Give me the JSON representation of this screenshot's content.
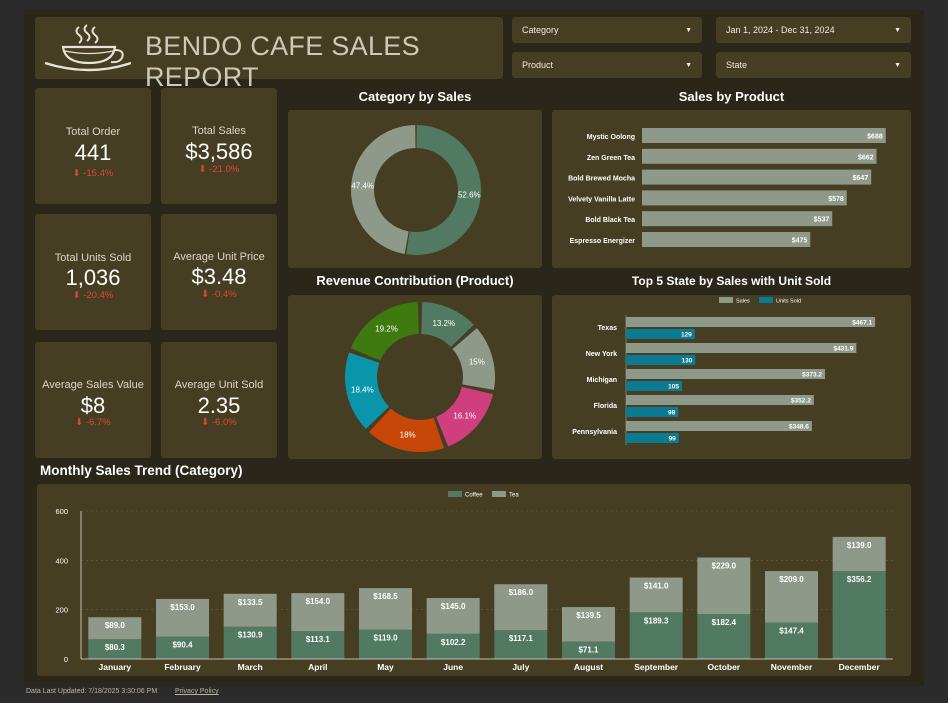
{
  "header": {
    "title": "BENDO CAFE SALES REPORT"
  },
  "filters": {
    "category": "Category",
    "product": "Product",
    "date_range": "Jan 1, 2024 - Dec 31, 2024",
    "state": "State"
  },
  "kpis": [
    {
      "label": "Total Order",
      "value": "441",
      "delta": "⬇ -15.4%"
    },
    {
      "label": "Total Sales",
      "value": "$3,586",
      "delta": "⬇ -21.0%"
    },
    {
      "label": "Total Units Sold",
      "value": "1,036",
      "delta": "⬇ -20.4%"
    },
    {
      "label": "Average Unit Price",
      "value": "$3.48",
      "delta": "⬇ -0.4%"
    },
    {
      "label": "Average Sales Value",
      "value": "$8",
      "delta": "⬇ -6.7%"
    },
    {
      "label": "Average Unit Sold",
      "value": "2.35",
      "delta": "⬇ -6.0%"
    }
  ],
  "colors": {
    "coffee": "#527a62",
    "tea": "#8e998a",
    "units": "#0a7b93",
    "panel": "#463e22",
    "background": "#2a2619",
    "negative": "#e0463b"
  },
  "footer": {
    "updated": "Data Last Updated: 7/18/2025 3:30:06 PM",
    "privacy": "Privacy Policy"
  },
  "chart_data": [
    {
      "type": "pie",
      "title": "Category by Sales",
      "donut": true,
      "categories": [
        "Coffee",
        "Tea"
      ],
      "values": [
        52.6,
        47.4
      ],
      "labels": [
        "52.6%",
        "47.4%"
      ],
      "colors": [
        "#527a62",
        "#8e998a"
      ]
    },
    {
      "type": "bar",
      "orientation": "horizontal",
      "title": "Sales by Product",
      "categories": [
        "Mystic Oolong",
        "Zen Green Tea",
        "Bold Brewed Mocha",
        "Velvety Vanilla Latte",
        "Bold Black Tea",
        "Espresso Energizer"
      ],
      "values": [
        688,
        662,
        647,
        578,
        537,
        475
      ],
      "labels": [
        "$688",
        "$662",
        "$647",
        "$578",
        "$537",
        "$475"
      ],
      "xlim": [
        0,
        700
      ]
    },
    {
      "type": "pie",
      "title": "Revenue Contribution (Product)",
      "donut": true,
      "values": [
        13.2,
        15,
        16.1,
        18,
        18.4,
        19.2
      ],
      "labels": [
        "13.2%",
        "15%",
        "16.1%",
        "18%",
        "18.4%",
        "19.2%"
      ],
      "colors": [
        "#527a62",
        "#8e998a",
        "#cf3f7e",
        "#c84608",
        "#0a95ab",
        "#3f7a10"
      ]
    },
    {
      "type": "bar",
      "orientation": "horizontal",
      "title": "Top 5 State by Sales with Unit Sold",
      "categories": [
        "Texas",
        "New York",
        "Michigan",
        "Florida",
        "Pennsylvania"
      ],
      "series": [
        {
          "name": "Sales",
          "values": [
            467.1,
            431.9,
            373.2,
            352.2,
            348.6
          ],
          "labels": [
            "$467.1",
            "$431.9",
            "$373.2",
            "$352.2",
            "$348.6"
          ]
        },
        {
          "name": "Units Sold",
          "values": [
            129,
            130,
            105,
            98,
            99
          ],
          "labels": [
            "129",
            "130",
            "105",
            "98",
            "99"
          ]
        }
      ],
      "legend": "top-center",
      "xlim": [
        0,
        480
      ]
    },
    {
      "type": "bar",
      "stacked": true,
      "title": "Monthly Sales Trend (Category)",
      "categories": [
        "January",
        "February",
        "March",
        "April",
        "May",
        "June",
        "July",
        "August",
        "September",
        "October",
        "November",
        "December"
      ],
      "series": [
        {
          "name": "Coffee",
          "values": [
            80.3,
            90.4,
            130.9,
            113.1,
            119.0,
            102.2,
            117.1,
            71.1,
            189.3,
            182.4,
            147.4,
            356.2
          ],
          "labels": [
            "$80.3",
            "$90.4",
            "$130.9",
            "$113.1",
            "$119.0",
            "$102.2",
            "$117.1",
            "$71.1",
            "$189.3",
            "$182.4",
            "$147.4",
            "$356.2"
          ]
        },
        {
          "name": "Tea",
          "values": [
            89.0,
            153.0,
            133.5,
            154.0,
            168.5,
            145.0,
            186.0,
            139.5,
            141.0,
            229.0,
            209.0,
            139.0
          ],
          "labels": [
            "$89.0",
            "$153.0",
            "$133.5",
            "$154.0",
            "$168.5",
            "$145.0",
            "$186.0",
            "$139.5",
            "$141.0",
            "$229.0",
            "$209.0",
            "$139.0"
          ]
        }
      ],
      "yticks": [
        "0",
        "200",
        "400",
        "600"
      ],
      "ylim": [
        0,
        600
      ],
      "legend": "top-center",
      "grid": true
    }
  ]
}
